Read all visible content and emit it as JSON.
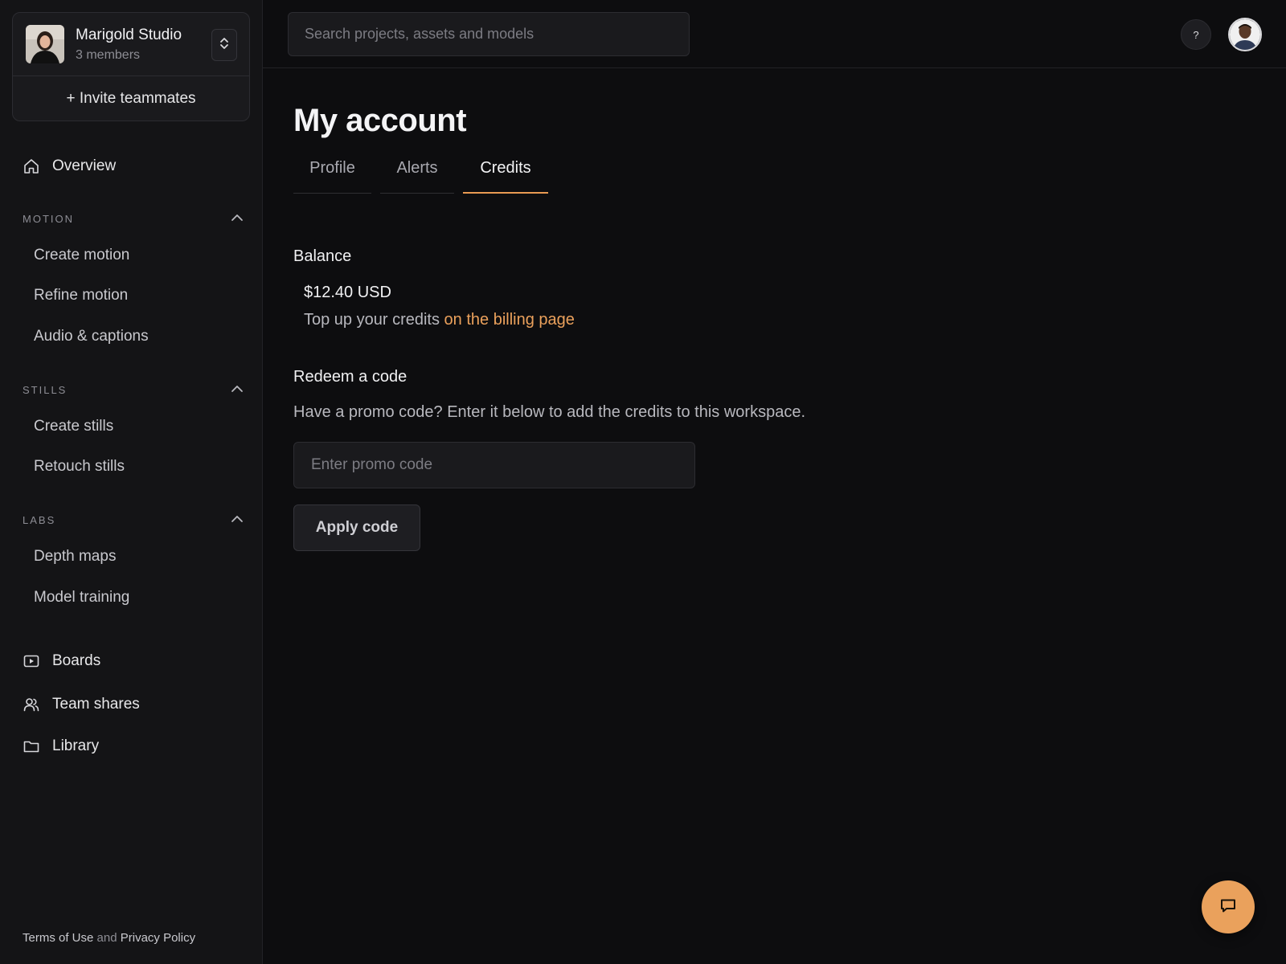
{
  "workspace": {
    "name": "Marigold Studio",
    "members": "3 members",
    "invite_label": "+ Invite teammates"
  },
  "nav": {
    "overview": "Overview",
    "sections": [
      {
        "label": "MOTION",
        "items": [
          "Create motion",
          "Refine motion",
          "Audio & captions"
        ]
      },
      {
        "label": "STILLS",
        "items": [
          "Create stills",
          "Retouch stills"
        ]
      },
      {
        "label": "LABS",
        "items": [
          "Depth maps",
          "Model training"
        ]
      }
    ],
    "bottom": [
      "Boards",
      "Team shares",
      "Library"
    ]
  },
  "footer": {
    "terms": "Terms of Use",
    "and": "and",
    "privacy": "Privacy Policy"
  },
  "header": {
    "search_placeholder": "Search projects, assets and models",
    "help_label": "?"
  },
  "page": {
    "title": "My account",
    "tabs": [
      "Profile",
      "Alerts",
      "Credits"
    ],
    "active_tab": "Credits",
    "balance": {
      "heading": "Balance",
      "value": "$12.40 USD",
      "topup_text": "Top up your credits",
      "billing_link": "on the billing page"
    },
    "redeem": {
      "heading": "Redeem a code",
      "description": "Have a promo code? Enter it below to add the credits to this workspace.",
      "input_placeholder": "Enter promo code",
      "button_label": "Apply code"
    }
  },
  "colors": {
    "accent": "#e89a52",
    "background": "#0d0d0f",
    "sidebar": "#141416"
  },
  "icons": {
    "overview": "home-icon",
    "boards": "play-box-icon",
    "team_shares": "users-icon",
    "library": "folder-icon",
    "chat": "chat-bubble-icon"
  }
}
